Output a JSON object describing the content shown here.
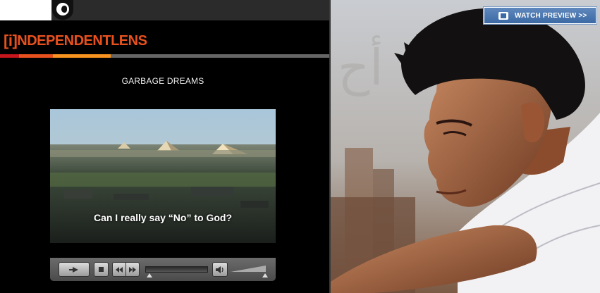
{
  "header": {
    "logo_icon": "pbs-logo-icon"
  },
  "brand": {
    "bracket": "[i]",
    "name_bold": "NDEPENDENT",
    "name_light": "LENS",
    "accent_color": "#e8511d"
  },
  "film": {
    "title": "GARBAGE DREAMS"
  },
  "video": {
    "subtitle": "Can I really say “No” to God?"
  },
  "player": {
    "progress": 0.0,
    "volume": 1.0,
    "icons": [
      "play-icon",
      "stop-icon",
      "rewind-icon",
      "fast-forward-icon",
      "volume-icon"
    ]
  },
  "preview": {
    "button_label": "WATCH PREVIEW >>",
    "button_color": "#4a77b0"
  }
}
